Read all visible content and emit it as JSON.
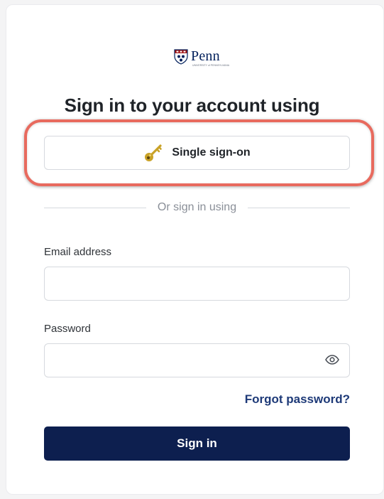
{
  "logo": {
    "name": "Penn",
    "tagline": "UNIVERSITY of PENNSYLVANIA"
  },
  "heading": "Sign in to your account using",
  "sso": {
    "label": "Single sign-on",
    "icon": "key-icon"
  },
  "divider": {
    "text": "Or sign in using"
  },
  "email": {
    "label": "Email address",
    "value": "",
    "placeholder": ""
  },
  "password": {
    "label": "Password",
    "value": "",
    "placeholder": "",
    "toggle_icon": "eye-icon"
  },
  "forgot": {
    "label": "Forgot password?"
  },
  "submit": {
    "label": "Sign in"
  },
  "colors": {
    "primary": "#0d1f4f",
    "link": "#1e3a78",
    "highlight": "#e86a5e",
    "key": "#c9a227"
  }
}
